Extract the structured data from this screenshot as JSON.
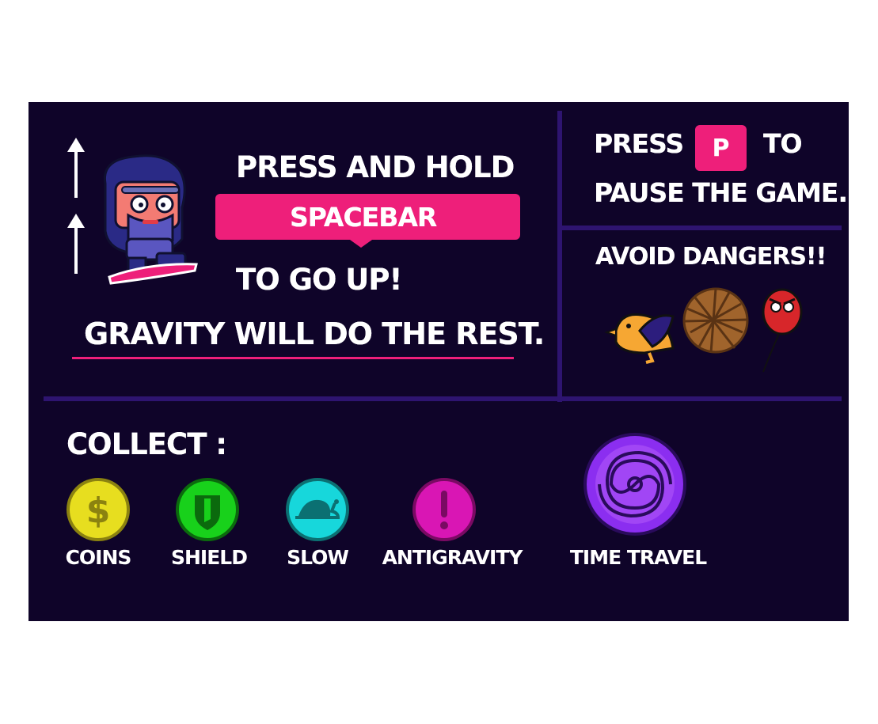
{
  "controls": {
    "press_and_hold": "PRESS AND HOLD",
    "spacebar_key": "SPACEBAR",
    "to_go_up": "TO GO UP!",
    "gravity_note": "GRAVITY WILL DO THE REST."
  },
  "pause": {
    "press": "PRESS",
    "key": "P",
    "to": "TO",
    "pause_text": "PAUSE THE GAME."
  },
  "dangers": {
    "title": "AVOID DANGERS!!",
    "icons": [
      "bird-icon",
      "tumbleweed-icon",
      "angry-balloon-icon"
    ]
  },
  "collect": {
    "title": "COLLECT :",
    "items": [
      {
        "label": "COINS",
        "icon": "dollar-coin-icon",
        "color": "#e7de1f"
      },
      {
        "label": "SHIELD",
        "icon": "shield-icon",
        "color": "#18d11b"
      },
      {
        "label": "SLOW",
        "icon": "snail-icon",
        "color": "#17d7db"
      },
      {
        "label": "ANTIGRAVITY",
        "icon": "antigravity-icon",
        "color": "#d916b4"
      },
      {
        "label": "TIME TRAVEL",
        "icon": "vortex-icon",
        "color": "#8b2ef0"
      }
    ]
  },
  "colors": {
    "background": "#0f0429",
    "divider": "#2e1470",
    "accent": "#ee1f7a"
  }
}
